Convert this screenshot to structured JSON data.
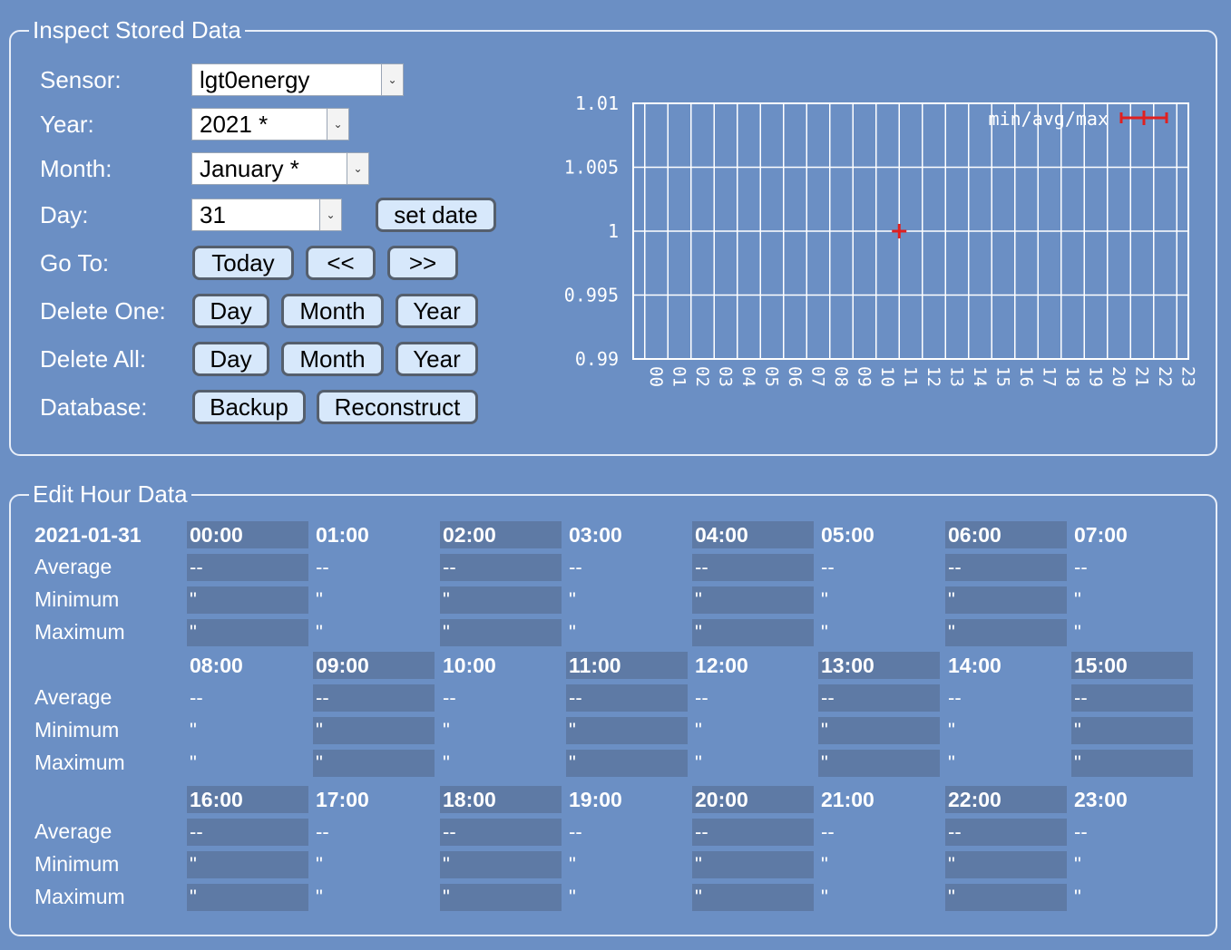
{
  "inspect": {
    "legend": "Inspect Stored Data",
    "labels": {
      "sensor": "Sensor:",
      "year": "Year:",
      "month": "Month:",
      "day": "Day:",
      "goto": "Go To:",
      "delete_one": "Delete One:",
      "delete_all": "Delete All:",
      "database": "Database:"
    },
    "selects": {
      "sensor": "lgt0energy",
      "year": "2021 *",
      "month": "January *",
      "day": "31"
    },
    "buttons": {
      "set_date": "set date",
      "today": "Today",
      "prev": "<<",
      "next": ">>",
      "del_one_day": "Day",
      "del_one_month": "Month",
      "del_one_year": "Year",
      "del_all_day": "Day",
      "del_all_month": "Month",
      "del_all_year": "Year",
      "backup": "Backup",
      "reconstruct": "Reconstruct"
    }
  },
  "chart_data": {
    "type": "scatter",
    "title": "",
    "xlabel": "",
    "ylabel": "",
    "categories": [
      "00",
      "01",
      "02",
      "03",
      "04",
      "05",
      "06",
      "07",
      "08",
      "09",
      "10",
      "11",
      "12",
      "13",
      "14",
      "15",
      "16",
      "17",
      "18",
      "19",
      "20",
      "21",
      "22",
      "23"
    ],
    "ylim": [
      0.99,
      1.01
    ],
    "yticks": [
      "1.01",
      "1.005",
      "1",
      "0.995",
      "0.99"
    ],
    "legend": "min/avg/max",
    "legend_position": "top-right",
    "grid": true,
    "series": [
      {
        "name": "min/avg/max",
        "color": "#e02020",
        "points": [
          {
            "x": "11",
            "min": 1,
            "avg": 1,
            "max": 1
          }
        ]
      }
    ]
  },
  "edit": {
    "legend": "Edit Hour Data",
    "date": "2021-01-31",
    "row_labels": {
      "average": "Average",
      "minimum": "Minimum",
      "maximum": "Maximum"
    },
    "hours": [
      {
        "h": "00:00",
        "avg": "--",
        "min": "\"",
        "max": "\""
      },
      {
        "h": "01:00",
        "avg": "--",
        "min": "\"",
        "max": "\""
      },
      {
        "h": "02:00",
        "avg": "--",
        "min": "\"",
        "max": "\""
      },
      {
        "h": "03:00",
        "avg": "--",
        "min": "\"",
        "max": "\""
      },
      {
        "h": "04:00",
        "avg": "--",
        "min": "\"",
        "max": "\""
      },
      {
        "h": "05:00",
        "avg": "--",
        "min": "\"",
        "max": "\""
      },
      {
        "h": "06:00",
        "avg": "--",
        "min": "\"",
        "max": "\""
      },
      {
        "h": "07:00",
        "avg": "--",
        "min": "\"",
        "max": "\""
      },
      {
        "h": "08:00",
        "avg": "--",
        "min": "\"",
        "max": "\""
      },
      {
        "h": "09:00",
        "avg": "--",
        "min": "\"",
        "max": "\""
      },
      {
        "h": "10:00",
        "avg": "--",
        "min": "\"",
        "max": "\""
      },
      {
        "h": "11:00",
        "avg": "--",
        "min": "\"",
        "max": "\""
      },
      {
        "h": "12:00",
        "avg": "--",
        "min": "\"",
        "max": "\""
      },
      {
        "h": "13:00",
        "avg": "--",
        "min": "\"",
        "max": "\""
      },
      {
        "h": "14:00",
        "avg": "--",
        "min": "\"",
        "max": "\""
      },
      {
        "h": "15:00",
        "avg": "--",
        "min": "\"",
        "max": "\""
      },
      {
        "h": "16:00",
        "avg": "--",
        "min": "\"",
        "max": "\""
      },
      {
        "h": "17:00",
        "avg": "--",
        "min": "\"",
        "max": "\""
      },
      {
        "h": "18:00",
        "avg": "--",
        "min": "\"",
        "max": "\""
      },
      {
        "h": "19:00",
        "avg": "--",
        "min": "\"",
        "max": "\""
      },
      {
        "h": "20:00",
        "avg": "--",
        "min": "\"",
        "max": "\""
      },
      {
        "h": "21:00",
        "avg": "--",
        "min": "\"",
        "max": "\""
      },
      {
        "h": "22:00",
        "avg": "--",
        "min": "\"",
        "max": "\""
      },
      {
        "h": "23:00",
        "avg": "--",
        "min": "\"",
        "max": "\""
      }
    ]
  }
}
